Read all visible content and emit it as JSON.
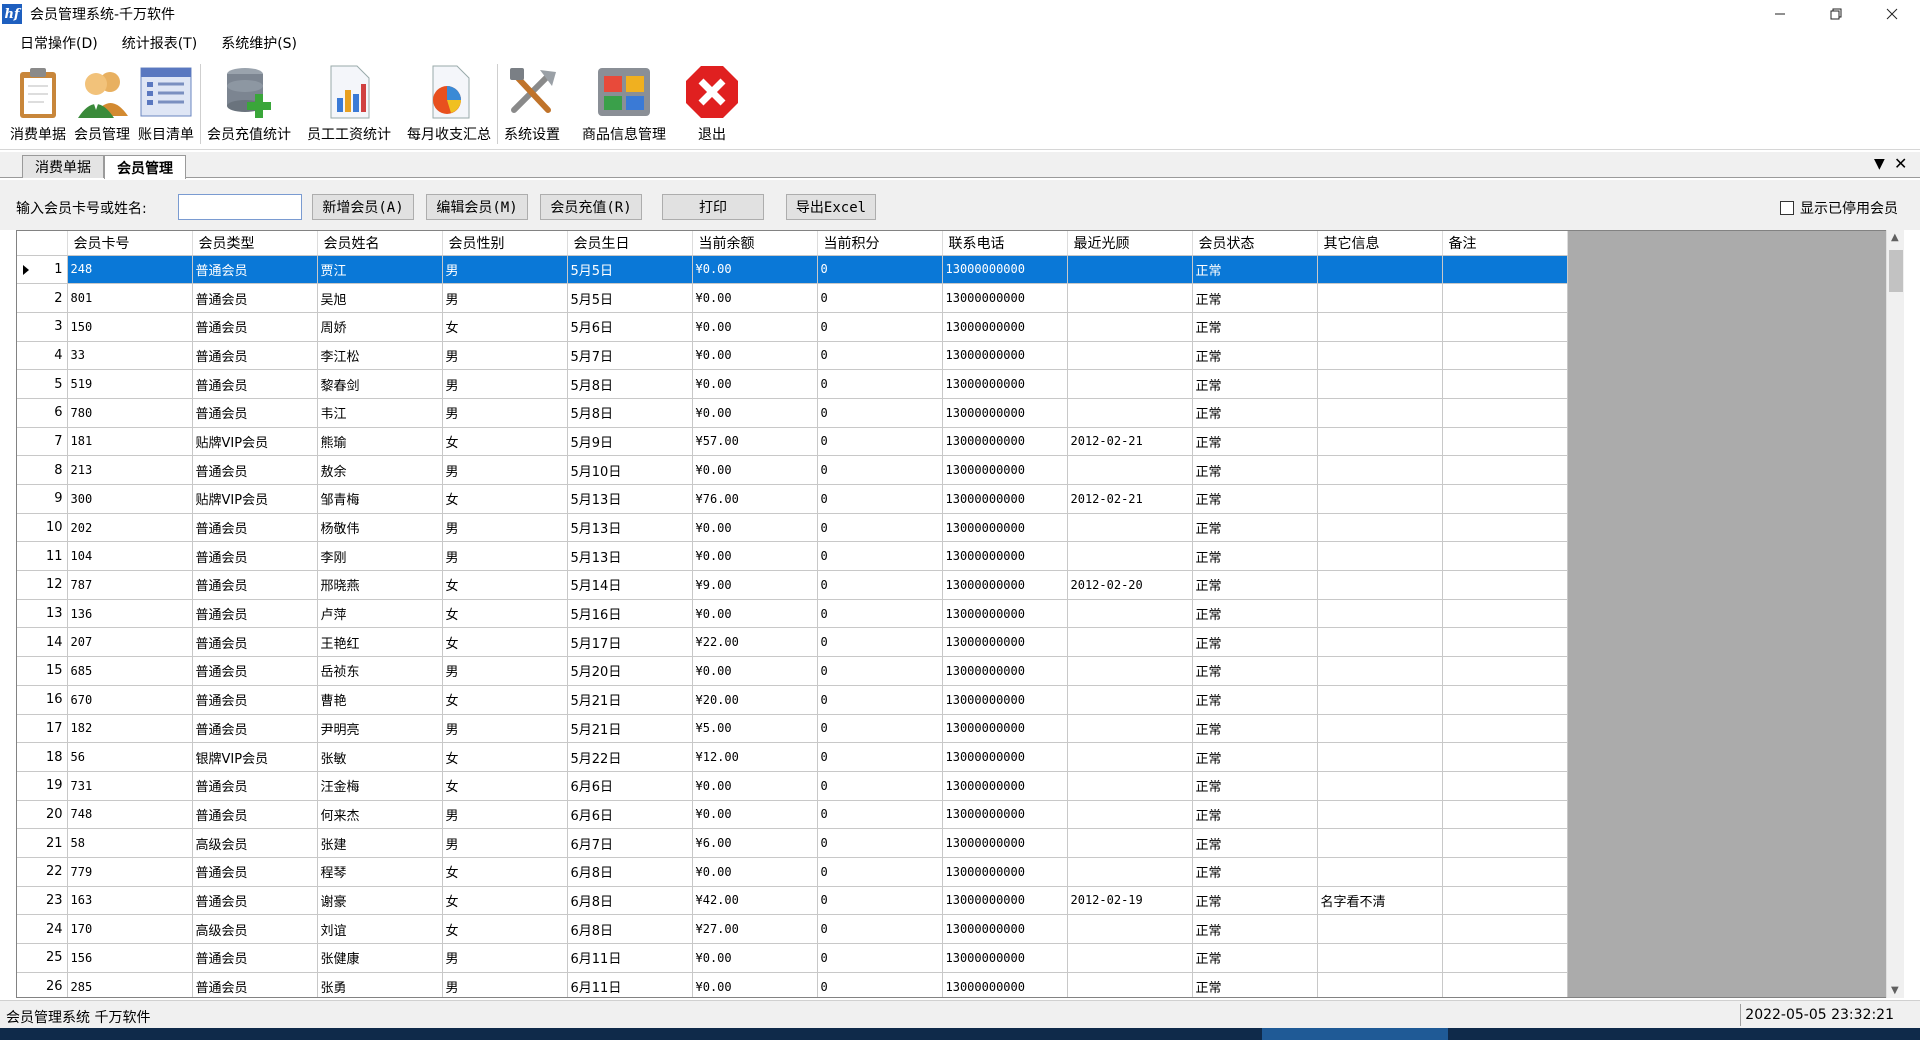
{
  "window": {
    "title": "会员管理系统-千万软件",
    "icon_text": "hf",
    "controls": [
      "minimize-icon",
      "restore-icon",
      "close-icon"
    ]
  },
  "menu": [
    "日常操作(D)",
    "统计报表(T)",
    "系统维护(S)"
  ],
  "toolbar": [
    {
      "label": "消费单据",
      "icon": "clipboard-icon"
    },
    {
      "label": "会员管理",
      "icon": "members-icon"
    },
    {
      "label": "账目清单",
      "icon": "list-icon"
    },
    {
      "label": "会员充值统计",
      "icon": "database-add-icon"
    },
    {
      "label": "员工工资统计",
      "icon": "bar-chart-icon"
    },
    {
      "label": "每月收支汇总",
      "icon": "pie-chart-icon"
    },
    {
      "label": "系统设置",
      "icon": "tools-icon"
    },
    {
      "label": "商品信息管理",
      "icon": "grid-icon"
    },
    {
      "label": "退出",
      "icon": "exit-icon"
    }
  ],
  "tabs": [
    {
      "label": "消费单据",
      "active": false
    },
    {
      "label": "会员管理",
      "active": true
    }
  ],
  "search": {
    "label": "输入会员卡号或姓名:",
    "value": "",
    "buttons": [
      "新增会员(A)",
      "编辑会员(M)",
      "会员充值(R)",
      "打印",
      "导出Excel"
    ],
    "checkbox_label": "显示已停用会员",
    "checkbox_checked": false
  },
  "grid": {
    "columns": [
      "会员卡号",
      "会员类型",
      "会员姓名",
      "会员性别",
      "会员生日",
      "当前余额",
      "当前积分",
      "联系电话",
      "最近光顾",
      "会员状态",
      "其它信息",
      "备注"
    ],
    "selected_row": 0,
    "rows": [
      [
        "1",
        "248",
        "普通会员",
        "贾江",
        "男",
        "5月5日",
        "¥0.00",
        "0",
        "13000000000",
        "",
        "正常",
        "",
        ""
      ],
      [
        "2",
        "801",
        "普通会员",
        "吴旭",
        "男",
        "5月5日",
        "¥0.00",
        "0",
        "13000000000",
        "",
        "正常",
        "",
        ""
      ],
      [
        "3",
        "150",
        "普通会员",
        "周娇",
        "女",
        "5月6日",
        "¥0.00",
        "0",
        "13000000000",
        "",
        "正常",
        "",
        ""
      ],
      [
        "4",
        "33",
        "普通会员",
        "李江松",
        "男",
        "5月7日",
        "¥0.00",
        "0",
        "13000000000",
        "",
        "正常",
        "",
        ""
      ],
      [
        "5",
        "519",
        "普通会员",
        "黎春剑",
        "男",
        "5月8日",
        "¥0.00",
        "0",
        "13000000000",
        "",
        "正常",
        "",
        ""
      ],
      [
        "6",
        "780",
        "普通会员",
        "韦江",
        "男",
        "5月8日",
        "¥0.00",
        "0",
        "13000000000",
        "",
        "正常",
        "",
        ""
      ],
      [
        "7",
        "181",
        "贴牌VIP会员",
        "熊瑜",
        "女",
        "5月9日",
        "¥57.00",
        "0",
        "13000000000",
        "2012-02-21",
        "正常",
        "",
        ""
      ],
      [
        "8",
        "213",
        "普通会员",
        "敖余",
        "男",
        "5月10日",
        "¥0.00",
        "0",
        "13000000000",
        "",
        "正常",
        "",
        ""
      ],
      [
        "9",
        "300",
        "贴牌VIP会员",
        "邹青梅",
        "女",
        "5月13日",
        "¥76.00",
        "0",
        "13000000000",
        "2012-02-21",
        "正常",
        "",
        ""
      ],
      [
        "10",
        "202",
        "普通会员",
        "杨敬伟",
        "男",
        "5月13日",
        "¥0.00",
        "0",
        "13000000000",
        "",
        "正常",
        "",
        ""
      ],
      [
        "11",
        "104",
        "普通会员",
        "李刚",
        "男",
        "5月13日",
        "¥0.00",
        "0",
        "13000000000",
        "",
        "正常",
        "",
        ""
      ],
      [
        "12",
        "787",
        "普通会员",
        "邢晓燕",
        "女",
        "5月14日",
        "¥9.00",
        "0",
        "13000000000",
        "2012-02-20",
        "正常",
        "",
        ""
      ],
      [
        "13",
        "136",
        "普通会员",
        "卢萍",
        "女",
        "5月16日",
        "¥0.00",
        "0",
        "13000000000",
        "",
        "正常",
        "",
        ""
      ],
      [
        "14",
        "207",
        "普通会员",
        "王艳红",
        "女",
        "5月17日",
        "¥22.00",
        "0",
        "13000000000",
        "",
        "正常",
        "",
        ""
      ],
      [
        "15",
        "685",
        "普通会员",
        "岳祯东",
        "男",
        "5月20日",
        "¥0.00",
        "0",
        "13000000000",
        "",
        "正常",
        "",
        ""
      ],
      [
        "16",
        "670",
        "普通会员",
        "曹艳",
        "女",
        "5月21日",
        "¥20.00",
        "0",
        "13000000000",
        "",
        "正常",
        "",
        ""
      ],
      [
        "17",
        "182",
        "普通会员",
        "尹明亮",
        "男",
        "5月21日",
        "¥5.00",
        "0",
        "13000000000",
        "",
        "正常",
        "",
        ""
      ],
      [
        "18",
        "56",
        "银牌VIP会员",
        "张敏",
        "女",
        "5月22日",
        "¥12.00",
        "0",
        "13000000000",
        "",
        "正常",
        "",
        ""
      ],
      [
        "19",
        "731",
        "普通会员",
        "汪金梅",
        "女",
        "6月6日",
        "¥0.00",
        "0",
        "13000000000",
        "",
        "正常",
        "",
        ""
      ],
      [
        "20",
        "748",
        "普通会员",
        "何来杰",
        "男",
        "6月6日",
        "¥0.00",
        "0",
        "13000000000",
        "",
        "正常",
        "",
        ""
      ],
      [
        "21",
        "58",
        "高级会员",
        "张建",
        "男",
        "6月7日",
        "¥6.00",
        "0",
        "13000000000",
        "",
        "正常",
        "",
        ""
      ],
      [
        "22",
        "779",
        "普通会员",
        "程琴",
        "女",
        "6月8日",
        "¥0.00",
        "0",
        "13000000000",
        "",
        "正常",
        "",
        ""
      ],
      [
        "23",
        "163",
        "普通会员",
        "谢豪",
        "女",
        "6月8日",
        "¥42.00",
        "0",
        "13000000000",
        "2012-02-19",
        "正常",
        "名字看不清",
        ""
      ],
      [
        "24",
        "170",
        "高级会员",
        "刘谊",
        "女",
        "6月8日",
        "¥27.00",
        "0",
        "13000000000",
        "",
        "正常",
        "",
        ""
      ],
      [
        "25",
        "156",
        "普通会员",
        "张健康",
        "男",
        "6月11日",
        "¥0.00",
        "0",
        "13000000000",
        "",
        "正常",
        "",
        ""
      ],
      [
        "26",
        "285",
        "普通会员",
        "张勇",
        "男",
        "6月11日",
        "¥0.00",
        "0",
        "13000000000",
        "",
        "正常",
        "",
        ""
      ]
    ]
  },
  "status": {
    "left": "会员管理系统  千万软件",
    "datetime": "2022-05-05 23:32:21"
  },
  "colors": {
    "selection": "#0a78d7",
    "grid_bg": "#ababab",
    "exit_red": "#e02020"
  }
}
